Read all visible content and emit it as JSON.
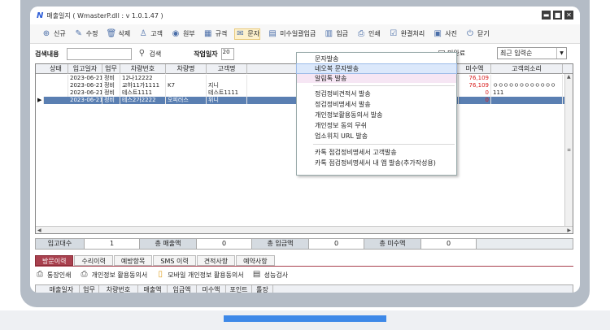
{
  "window": {
    "logo": "N",
    "title": "매출일지 ( WmasterP.dll : v 1.0.1.47 )",
    "controls": [
      "▬",
      "■",
      "✕"
    ]
  },
  "toolbar": {
    "items": [
      {
        "icon": "plus-circle-icon",
        "glyph": "⊕",
        "label": "신규"
      },
      {
        "icon": "pencil-icon",
        "glyph": "✎",
        "label": "수정"
      },
      {
        "icon": "trash-icon",
        "glyph": "🗑",
        "label": "삭제"
      },
      {
        "icon": "person-icon",
        "glyph": "♙",
        "label": "고객"
      },
      {
        "icon": "eye-icon",
        "glyph": "◉",
        "label": "원부"
      },
      {
        "icon": "rule-icon",
        "glyph": "▦",
        "label": "규격"
      },
      {
        "icon": "message-icon",
        "glyph": "✉",
        "label": "문자"
      },
      {
        "icon": "receipt-icon",
        "glyph": "▤",
        "label": "미수일괄입금"
      },
      {
        "icon": "document-icon",
        "glyph": "▥",
        "label": "입금"
      },
      {
        "icon": "printer-icon",
        "glyph": "⎙",
        "label": "인쇄"
      },
      {
        "icon": "check-doc-icon",
        "glyph": "☑",
        "label": "완결처리"
      },
      {
        "icon": "photo-icon",
        "glyph": "▣",
        "label": "사진"
      },
      {
        "icon": "power-icon",
        "glyph": "⏻",
        "label": "닫기"
      }
    ]
  },
  "search": {
    "label": "검색내용",
    "value": "",
    "button": "검색",
    "date_label": "작업일자",
    "date_value": "20",
    "checkbox_label": "미완료",
    "sort_value": "최근 입력순"
  },
  "grid": {
    "columns": [
      "상태",
      "입고일자",
      "업무",
      "차량번호",
      "차량명",
      "고객명",
      "",
      "미수액",
      "고객의소리"
    ],
    "rows": [
      {
        "state": "",
        "date": "2023-06-21",
        "work": "정비",
        "plate": "12나12222",
        "car": "",
        "cust": "",
        "unpaid_prefix": "0",
        "unpaid": "76,109",
        "voice": "",
        "selected": false
      },
      {
        "state": "",
        "date": "2023-06-21",
        "work": "정비",
        "plate": "교하11가1111",
        "car": "K7",
        "cust": "지니",
        "unpaid_prefix": "0",
        "unpaid": "76,109",
        "voice": "ㅇㅇㅇㅇㅇㅇㅇㅇㅇㅇㅇㅇ",
        "selected": false
      },
      {
        "state": "",
        "date": "2023-06-21",
        "work": "정비",
        "plate": "테스트1111",
        "car": "",
        "cust": "테스트1111",
        "unpaid_prefix": "0",
        "unpaid": "0",
        "voice": "111",
        "selected": false
      },
      {
        "state": "▶",
        "date": "2023-06-21",
        "work": "정비",
        "plate": "테스2가2222",
        "car": "오피러스",
        "cust": "위니",
        "unpaid_prefix": "0",
        "unpaid": "0",
        "voice": "",
        "selected": true
      }
    ]
  },
  "totals": {
    "count_label": "입고대수",
    "count": "1",
    "sales_label": "총 매출액",
    "sales": "0",
    "income_label": "총 입금액",
    "income": "0",
    "unpaid_label": "총 미수액",
    "unpaid": "0"
  },
  "tabs": [
    "방문이력",
    "수리이력",
    "예방항목",
    "SMS 이력",
    "견적사항",
    "예약사항"
  ],
  "actions": [
    {
      "icon": "printer-icon",
      "glyph": "⎙",
      "label": "통장인쇄"
    },
    {
      "icon": "printer-icon",
      "glyph": "⎙",
      "label": "개인정보 활용동의서"
    },
    {
      "icon": "mobile-icon",
      "glyph": "▯",
      "label": "모바일 개인정보 활용동의서"
    },
    {
      "icon": "clipboard-icon",
      "glyph": "▤",
      "label": "성능검사"
    }
  ],
  "grid2": {
    "columns": [
      "매출일자",
      "업무",
      "차량번호",
      "매출액",
      "입금액",
      "미수액",
      "포인트",
      "톨장"
    ]
  },
  "menu": {
    "items": [
      {
        "label": "문자발송"
      },
      {
        "label": "네오복 문자발송"
      },
      {
        "label": "알림톡 발송"
      },
      {
        "label": "정검정비견적서 발송"
      },
      {
        "label": "정검정비명세서 발송"
      },
      {
        "label": "개인정보활용동의서 발송"
      },
      {
        "label": "개인정보 동의 무쉬"
      },
      {
        "label": "업소위치 URL 발송"
      },
      {
        "label": "카톡 점검정비명세서 고객발송"
      },
      {
        "label": "카톡 점검정비명세서 내 앱 발송(추가작성용)"
      }
    ]
  }
}
